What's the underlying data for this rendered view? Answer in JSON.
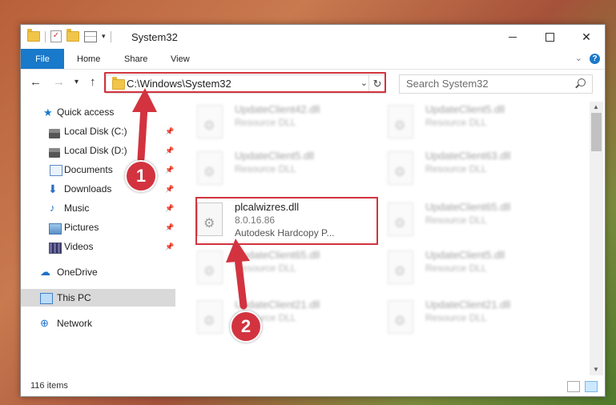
{
  "window": {
    "title": "System32",
    "controls": {
      "minimize": "",
      "maximize": "",
      "close": "✕"
    }
  },
  "quick_access_toolbar": {
    "dropdown": "▾",
    "check_glyph": "✓"
  },
  "ribbon": {
    "tabs": [
      {
        "label": "File",
        "active": true
      },
      {
        "label": "Home"
      },
      {
        "label": "Share"
      },
      {
        "label": "View"
      }
    ],
    "collapse": "⌄",
    "help": "?"
  },
  "nav": {
    "back": "←",
    "forward": "→",
    "recent": "▾",
    "up": "↑",
    "address": "C:\\Windows\\System32",
    "address_dropdown": "⌄",
    "refresh": "↻",
    "search_placeholder": "Search System32"
  },
  "sidebar": {
    "items": [
      {
        "label": "Quick access",
        "icon": "star-icon",
        "glyph": "★"
      },
      {
        "label": "Local Disk (C:)",
        "icon": "drive-icon",
        "pinned": true
      },
      {
        "label": "Local Disk (D:)",
        "icon": "drive-icon",
        "pinned": true
      },
      {
        "label": "Documents",
        "icon": "documents-icon",
        "pinned": true
      },
      {
        "label": "Downloads",
        "icon": "downloads-icon",
        "glyph": "⬇",
        "pinned": true
      },
      {
        "label": "Music",
        "icon": "music-icon",
        "glyph": "♪",
        "pinned": true
      },
      {
        "label": "Pictures",
        "icon": "pictures-icon",
        "pinned": true
      },
      {
        "label": "Videos",
        "icon": "videos-icon",
        "pinned": true
      },
      {
        "label": "OneDrive",
        "icon": "onedrive-icon",
        "glyph": "☁"
      },
      {
        "label": "This PC",
        "icon": "this-pc-icon",
        "selected": true
      },
      {
        "label": "Network",
        "icon": "network-icon",
        "glyph": "⊕"
      }
    ],
    "pin_glyph": "📌"
  },
  "files": [
    {
      "name": "UpdateClient42.dll",
      "desc": "Resource DLL",
      "blurred": true
    },
    {
      "name": "UpdateClient5.dll",
      "desc": "Resource DLL",
      "blurred": true
    },
    {
      "name": "UpdateClient5.dll",
      "desc": "Resource DLL",
      "blurred": true
    },
    {
      "name": "UpdateClient63.dll",
      "desc": "Resource DLL",
      "blurred": true
    },
    {
      "name": "plcalwizres.dll",
      "version": "8.0.16.86",
      "desc": "Autodesk Hardcopy P...",
      "blurred": false
    },
    {
      "name": "UpdateClient65.dll",
      "desc": "Resource DLL",
      "blurred": true
    },
    {
      "name": "UpdateClient65.dll",
      "desc": "Resource DLL",
      "blurred": true
    },
    {
      "name": "UpdateClient5.dll",
      "desc": "Resource DLL",
      "blurred": true
    },
    {
      "name": "UpdateClient21.dll",
      "desc": "Resource DLL",
      "blurred": true
    },
    {
      "name": "UpdateClient21.dll",
      "desc": "Resource DLL",
      "blurred": true
    }
  ],
  "file_icon_glyph": "⚙",
  "scrollbar": {
    "up": "▲",
    "down": "▼"
  },
  "status": {
    "item_count": "116 items"
  },
  "annotations": {
    "step1": "1",
    "step2": "2"
  },
  "colors": {
    "accent": "#1979ca",
    "highlight": "#d2333f"
  }
}
